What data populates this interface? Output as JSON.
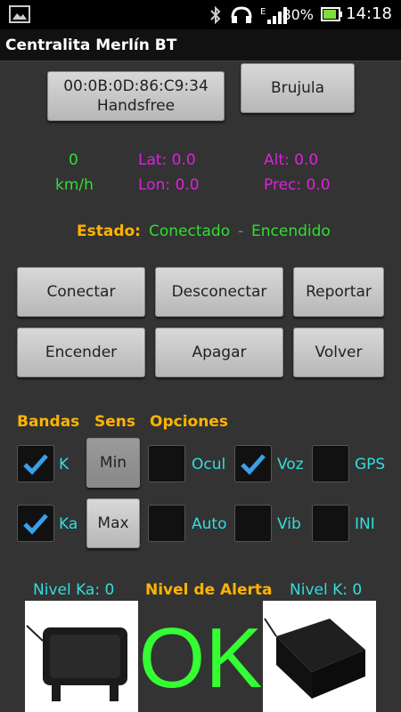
{
  "status_bar": {
    "battery_pct": "80%",
    "time": "14:18"
  },
  "app": {
    "title": "Centralita Merlín BT"
  },
  "device_button": {
    "line1": "00:0B:0D:86:C9:34",
    "line2": "Handsfree"
  },
  "compass_button": "Brujula",
  "speed": {
    "value": "0",
    "unit": "km/h"
  },
  "gps": {
    "lat": "Lat: 0.0",
    "lon": "Lon: 0.0",
    "alt": "Alt: 0.0",
    "prec": "Prec: 0.0"
  },
  "estado": {
    "label": "Estado:",
    "conn": "Conectado",
    "sep": "-",
    "power": "Encendido"
  },
  "buttons": {
    "connect": "Conectar",
    "disconnect": "Desconectar",
    "report": "Reportar",
    "power_on": "Encender",
    "power_off": "Apagar",
    "back": "Volver"
  },
  "sections": {
    "bands": "Bandas",
    "sens": "Sens",
    "options": "Opciones"
  },
  "bands": {
    "k": {
      "label": "K",
      "checked": true
    },
    "ka": {
      "label": "Ka",
      "checked": true
    }
  },
  "sens": {
    "min": "Min",
    "max": "Max"
  },
  "options": {
    "ocul": {
      "label": "Ocul",
      "checked": false
    },
    "voz": {
      "label": "Voz",
      "checked": true
    },
    "gps": {
      "label": "GPS",
      "checked": false
    },
    "auto": {
      "label": "Auto",
      "checked": false
    },
    "vib": {
      "label": "Vib",
      "checked": false
    },
    "ini": {
      "label": "INI",
      "checked": false
    }
  },
  "levels": {
    "ka": "Nivel Ka: 0",
    "alert": "Nivel de Alerta",
    "k": "Nivel K: 0",
    "status": "OK"
  },
  "colors": {
    "accent_green": "#33dd33",
    "magenta": "#dd22dd",
    "orange": "#ffb400",
    "cyan": "#33dddd"
  },
  "icons": {
    "gallery": "gallery-icon",
    "bluetooth": "bluetooth-icon",
    "headset": "headset-icon",
    "signal": "signal-icon",
    "battery": "battery-icon",
    "check": "checkmark-icon"
  }
}
